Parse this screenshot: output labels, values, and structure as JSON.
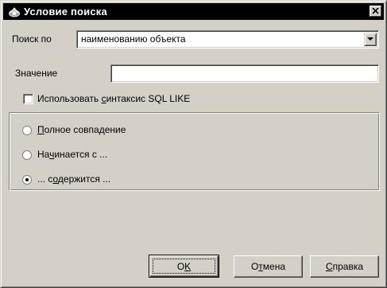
{
  "window": {
    "title": "Условие поиска",
    "close_glyph": "×"
  },
  "search_by": {
    "label": "Поиск по",
    "value": "наименованию объекта"
  },
  "value_field": {
    "label": "Значение",
    "value": ""
  },
  "sql_like": {
    "label_prefix": "Использовать ",
    "label_mnemonic": "с",
    "label_suffix": "интаксис SQL LIKE",
    "checked": false
  },
  "match_options": [
    {
      "before": "",
      "mnemonic": "П",
      "after": "олное совпадение",
      "selected": false
    },
    {
      "before": "На",
      "mnemonic": "ч",
      "after": "инается с ...",
      "selected": false
    },
    {
      "before": "... с",
      "mnemonic": "о",
      "after": "держится ...",
      "selected": true
    }
  ],
  "buttons": {
    "ok": {
      "before": "O",
      "mnemonic": "K",
      "after": ""
    },
    "cancel": {
      "before": "О",
      "mnemonic": "т",
      "after": "мена"
    },
    "help": {
      "before": "",
      "mnemonic": "С",
      "after": "правка"
    }
  },
  "colors": {
    "face": "#d4d0c8",
    "titlebar": "#000000",
    "field": "#ffffff"
  },
  "icons": {
    "title": "search-condition-icon",
    "close": "close-icon",
    "dropdown": "chevron-down-icon"
  }
}
